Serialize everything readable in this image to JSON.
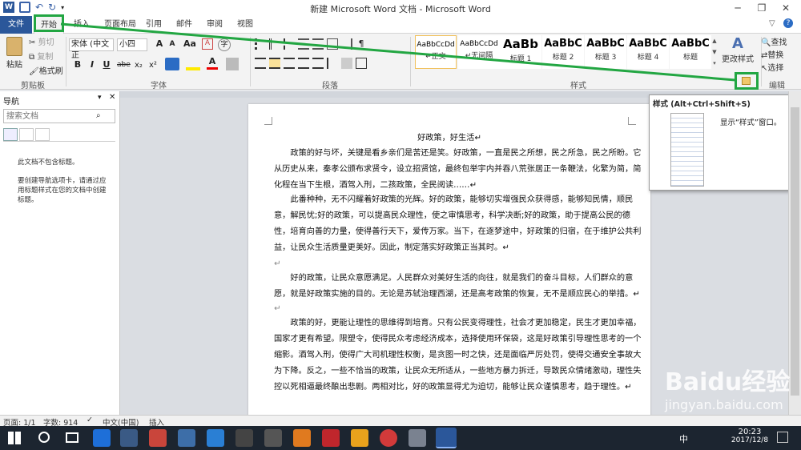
{
  "window": {
    "title": "新建 Microsoft Word 文档 - Microsoft Word"
  },
  "ribbon_tabs": [
    "文件",
    "开始",
    "插入",
    "页面布局",
    "引用",
    "邮件",
    "审阅",
    "视图"
  ],
  "clipboard": {
    "paste": "粘贴",
    "cut": "剪切",
    "copy": "复制",
    "format_painter": "格式刷",
    "group": "剪贴板"
  },
  "font": {
    "family": "宋体 (中文正",
    "size": "小四",
    "group": "字体",
    "enlarge": "A",
    "shrink": "A",
    "aa": "Aa",
    "bold": "B",
    "italic": "I",
    "underline": "U",
    "strike": "abe",
    "sub": "x₂",
    "sup": "x²",
    "color_a": "A",
    "clear": "A",
    "circle": "字"
  },
  "paragraph": {
    "group": "段落"
  },
  "styles": {
    "items": [
      {
        "preview": "AaBbCcDd",
        "name": "↵正文"
      },
      {
        "preview": "AaBbCcDd",
        "name": "↵无间隔"
      },
      {
        "preview": "AaBb",
        "name": "标题 1"
      },
      {
        "preview": "AaBbC",
        "name": "标题 2"
      },
      {
        "preview": "AaBbC",
        "name": "标题 3"
      },
      {
        "preview": "AaBbC",
        "name": "标题 4"
      },
      {
        "preview": "AaBbC",
        "name": "标题"
      }
    ],
    "change_styles": "更改样式",
    "group": "样式"
  },
  "editing": {
    "find": "查找",
    "replace": "替换",
    "select": "选择",
    "group": "编辑"
  },
  "tooltip": {
    "title": "样式 (Alt+Ctrl+Shift+S)",
    "desc": "显示“样式”窗口。"
  },
  "nav": {
    "title": "导航",
    "search_placeholder": "搜索文档",
    "no_headings": "此文档不包含标题。",
    "hint": "要创建导航选项卡，请通过应用标题样式在您的文档中创建标题。"
  },
  "document": {
    "heading": "好政策，好生活↵",
    "paragraphs": [
      "政策的好与坏，关键是看乡亲们是苦还是笑。好政策，一直是民之所想，民之所急，民之所盼。它从历史从来，秦孝公颁布求贤令，设立招贤馆，最终包举宇内并吞八荒张居正一条鞭法，化繁为简，简化程在当下生根，酒驾入刑，二孩政策，全民阅读……↵",
      "此番种种，无不闪耀着好政策的光辉。好的政策，能够切实增强民众获得感，能够知民情，顺民意，解民忧;好的政策，可以提高民众理性，使之审慎思考，科学决断;好的政策，助于提高公民的德性，培育向善的力量，使得善行天下，爱传万家。当下，在逐梦途中，好政策的归宿，在于维护公共利益，让民众生活质量更美好。因此，制定落实好政策正当其时。↵",
      "↵",
      "好的政策，让民众意愿满足。人民群众对美好生活的向往，就是我们的奋斗目标，人们群众的意愿，就是好政策实施的目的。无论是苏轼治理西湖，还是高考政策的恢复，无不是顺应民心的举措。↵",
      "↵",
      "政策的好，更能让理性的思维得到培育。只有公民变得理性，社会才更加稳定，民生才更加幸福，国家才更有希望。限塑令，使得民众考虑经济成本，选择使用环保袋，这是好政策引导理性思考的一个缩影。酒驾入刑，使得广大司机理性权衡，是贪图一时之快，还是面临严厉处罚，使得交通安全事故大为下降。反之，一些不恰当的政策，让民众无所适从，一些地方暴力拆迁，导致民众情绪激动，理性失控以死相逼最终酿出悲剧。两相对比，好的政策显得尤为迫切，能够让民众谨慎思考，趋于理性。↵"
    ]
  },
  "status": {
    "page": "页面: 1/1",
    "words": "字数: 914",
    "lang": "中文(中国)",
    "mode": "插入"
  },
  "taskbar": {
    "time": "20:23",
    "date": "2017/12/8",
    "ime": "中"
  },
  "watermark": {
    "text": "Baidu经验",
    "url": "jingyan.baidu.com"
  },
  "colors": {
    "accent": "#2b579a",
    "highlight": "#22a642"
  }
}
